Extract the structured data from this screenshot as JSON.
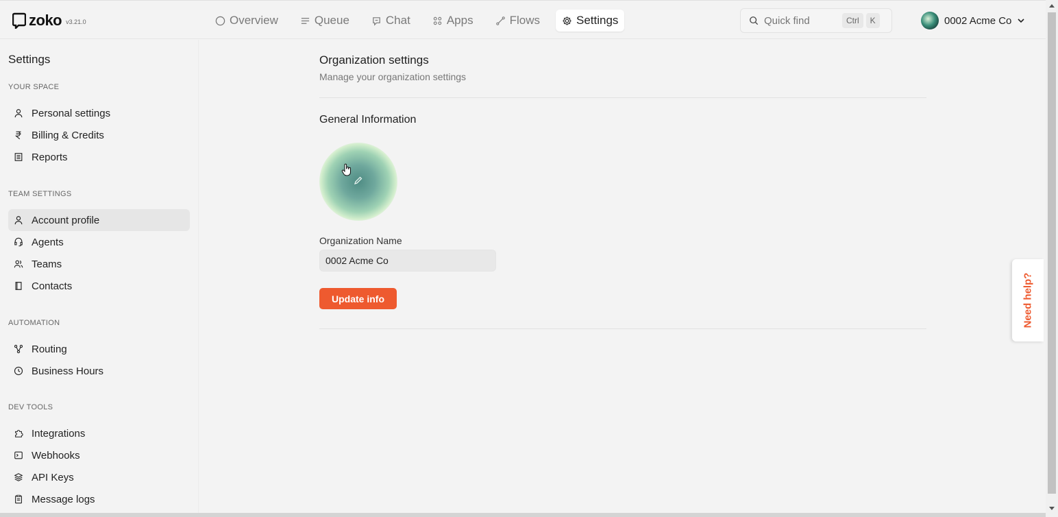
{
  "app": {
    "logo_text": "zoko",
    "version": "v3.21.0"
  },
  "nav": {
    "items": [
      {
        "label": "Overview",
        "icon": "circle-icon"
      },
      {
        "label": "Queue",
        "icon": "list-icon"
      },
      {
        "label": "Chat",
        "icon": "chat-icon"
      },
      {
        "label": "Apps",
        "icon": "grid-icon"
      },
      {
        "label": "Flows",
        "icon": "flow-icon"
      },
      {
        "label": "Settings",
        "icon": "gear-icon",
        "active": true
      }
    ]
  },
  "quickfind": {
    "placeholder": "Quick find",
    "kbd1": "Ctrl",
    "kbd2": "K"
  },
  "org_switcher": {
    "name": "0002 Acme Co"
  },
  "sidebar": {
    "title": "Settings",
    "sections": {
      "your_space": "YOUR SPACE",
      "team_settings": "TEAM SETTINGS",
      "automation": "AUTOMATION",
      "dev_tools": "DEV TOOLS"
    },
    "items": {
      "personal": "Personal settings",
      "billing": "Billing & Credits",
      "reports": "Reports",
      "account": "Account profile",
      "agents": "Agents",
      "teams": "Teams",
      "contacts": "Contacts",
      "routing": "Routing",
      "business_hours": "Business Hours",
      "integrations": "Integrations",
      "webhooks": "Webhooks",
      "api_keys": "API Keys",
      "message_logs": "Message logs"
    }
  },
  "main": {
    "title": "Organization settings",
    "subtitle": "Manage your organization settings",
    "section_title": "General Information",
    "org_name_label": "Organization Name",
    "org_name_value": "0002 Acme Co",
    "update_button": "Update info"
  },
  "help_tab": "Need help?",
  "colors": {
    "accent": "#ee5a2f"
  }
}
